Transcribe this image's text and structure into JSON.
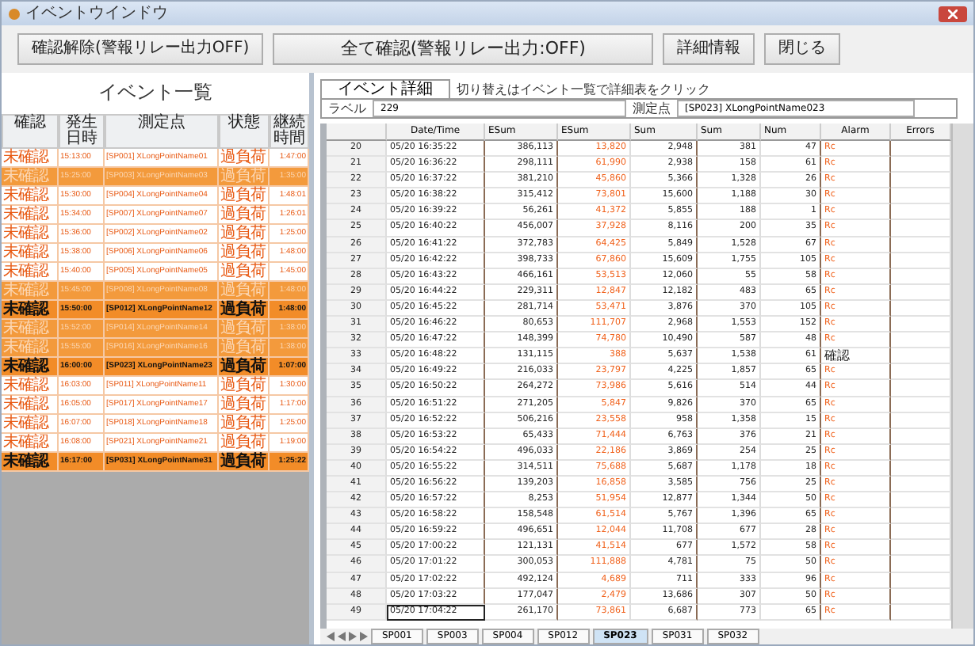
{
  "window": {
    "title": "イベントウインドウ"
  },
  "toolbar": {
    "buttons": [
      "確認解除(警報リレー出力OFF)",
      "全て確認(警報リレー出力:OFF)",
      "詳細情報",
      "閉じる"
    ]
  },
  "event_list": {
    "title": "イベント一覧",
    "columns": [
      "確認",
      "発生日時",
      "測定点",
      "状態",
      "継続時間"
    ],
    "rows": [
      {
        "kind": "plain",
        "ack": "未確認",
        "time": "15:13:00",
        "point": "[SP001] XLongPointName01",
        "status": "過負荷",
        "duration": "1:47:00"
      },
      {
        "kind": "alert",
        "ack": "未確認",
        "time": "15:25:00",
        "point": "[SP003] XLongPointName03",
        "status": "過負荷",
        "duration": "1:35:00"
      },
      {
        "kind": "plain",
        "ack": "未確認",
        "time": "15:30:00",
        "point": "[SP004] XLongPointName04",
        "status": "過負荷",
        "duration": "1:48:01"
      },
      {
        "kind": "plain",
        "ack": "未確認",
        "time": "15:34:00",
        "point": "[SP007] XLongPointName07",
        "status": "過負荷",
        "duration": "1:26:01"
      },
      {
        "kind": "plain",
        "ack": "未確認",
        "time": "15:36:00",
        "point": "[SP002] XLongPointName02",
        "status": "過負荷",
        "duration": "1:25:00"
      },
      {
        "kind": "plain",
        "ack": "未確認",
        "time": "15:38:00",
        "point": "[SP006] XLongPointName06",
        "status": "過負荷",
        "duration": "1:48:00"
      },
      {
        "kind": "plain",
        "ack": "未確認",
        "time": "15:40:00",
        "point": "[SP005] XLongPointName05",
        "status": "過負荷",
        "duration": "1:45:00"
      },
      {
        "kind": "alert",
        "ack": "未確認",
        "time": "15:45:00",
        "point": "[SP008] XLongPointName08",
        "status": "過負荷",
        "duration": "1:48:00"
      },
      {
        "kind": "active",
        "ack": "未確認",
        "time": "15:50:00",
        "point": "[SP012] XLongPointName12",
        "status": "過負荷",
        "duration": "1:48:00"
      },
      {
        "kind": "alert",
        "ack": "未確認",
        "time": "15:52:00",
        "point": "[SP014] XLongPointName14",
        "status": "過負荷",
        "duration": "1:38:00"
      },
      {
        "kind": "alert",
        "ack": "未確認",
        "time": "15:55:00",
        "point": "[SP016] XLongPointName16",
        "status": "過負荷",
        "duration": "1:38:00"
      },
      {
        "kind": "active",
        "ack": "未確認",
        "time": "16:00:00",
        "point": "[SP023] XLongPointName23",
        "status": "過負荷",
        "duration": "1:07:00"
      },
      {
        "kind": "plain",
        "ack": "未確認",
        "time": "16:03:00",
        "point": "[SP011] XLongPointName11",
        "status": "過負荷",
        "duration": "1:30:00"
      },
      {
        "kind": "plain",
        "ack": "未確認",
        "time": "16:05:00",
        "point": "[SP017] XLongPointName17",
        "status": "過負荷",
        "duration": "1:17:00"
      },
      {
        "kind": "plain",
        "ack": "未確認",
        "time": "16:07:00",
        "point": "[SP018] XLongPointName18",
        "status": "過負荷",
        "duration": "1:25:00"
      },
      {
        "kind": "plain",
        "ack": "未確認",
        "time": "16:08:00",
        "point": "[SP021] XLongPointName21",
        "status": "過負荷",
        "duration": "1:19:00"
      },
      {
        "kind": "active",
        "ack": "未確認",
        "time": "16:17:00",
        "point": "[SP031] XLongPointName31",
        "status": "過負荷",
        "duration": "1:25:22"
      }
    ]
  },
  "detail": {
    "tab": "イベント詳細",
    "note": "切り替えはイベント一覧で詳細表をクリック",
    "fields": [
      {
        "label": "ラベル",
        "value": "229"
      },
      {
        "label": "測定点",
        "value": "[SP023] XLongPointName023"
      }
    ],
    "columns": [
      "Date/Time",
      "ESum",
      "ESum",
      "Sum",
      "Sum",
      "Num",
      "Alarm",
      "Errors"
    ],
    "rows": [
      {
        "no": "20",
        "time": "05/20 16:35:22",
        "c1": "386,113",
        "c2": "13,820",
        "c3": "2,948",
        "c4": "381",
        "c5": "47",
        "alarm": "Rc"
      },
      {
        "no": "21",
        "time": "05/20 16:36:22",
        "c1": "298,111",
        "c2": "61,990",
        "c3": "2,938",
        "c4": "158",
        "c5": "61",
        "alarm": "Rc"
      },
      {
        "no": "22",
        "time": "05/20 16:37:22",
        "c1": "381,210",
        "c2": "45,860",
        "c3": "5,366",
        "c4": "1,328",
        "c5": "26",
        "alarm": "Rc"
      },
      {
        "no": "23",
        "time": "05/20 16:38:22",
        "c1": "315,412",
        "c2": "73,801",
        "c3": "15,600",
        "c4": "1,188",
        "c5": "30",
        "alarm": "Rc"
      },
      {
        "no": "24",
        "time": "05/20 16:39:22",
        "c1": "56,261",
        "c2": "41,372",
        "c3": "5,855",
        "c4": "188",
        "c5": "1",
        "alarm": "Rc"
      },
      {
        "no": "25",
        "time": "05/20 16:40:22",
        "c1": "456,007",
        "c2": "37,928",
        "c3": "8,116",
        "c4": "200",
        "c5": "35",
        "alarm": "Rc"
      },
      {
        "no": "26",
        "time": "05/20 16:41:22",
        "c1": "372,783",
        "c2": "64,425",
        "c3": "5,849",
        "c4": "1,528",
        "c5": "67",
        "alarm": "Rc"
      },
      {
        "no": "27",
        "time": "05/20 16:42:22",
        "c1": "398,733",
        "c2": "67,860",
        "c3": "15,609",
        "c4": "1,755",
        "c5": "105",
        "alarm": "Rc"
      },
      {
        "no": "28",
        "time": "05/20 16:43:22",
        "c1": "466,161",
        "c2": "53,513",
        "c3": "12,060",
        "c4": "55",
        "c5": "58",
        "alarm": "Rc"
      },
      {
        "no": "29",
        "time": "05/20 16:44:22",
        "c1": "229,311",
        "c2": "12,847",
        "c3": "12,182",
        "c4": "483",
        "c5": "65",
        "alarm": "Rc"
      },
      {
        "no": "30",
        "time": "05/20 16:45:22",
        "c1": "281,714",
        "c2": "53,471",
        "c3": "3,876",
        "c4": "370",
        "c5": "105",
        "alarm": "Rc"
      },
      {
        "no": "31",
        "time": "05/20 16:46:22",
        "c1": "80,653",
        "c2": "111,707",
        "c3": "2,968",
        "c4": "1,553",
        "c5": "152",
        "alarm": "Rc"
      },
      {
        "no": "32",
        "time": "05/20 16:47:22",
        "c1": "148,399",
        "c2": "74,780",
        "c3": "10,490",
        "c4": "587",
        "c5": "48",
        "alarm": "Rc"
      },
      {
        "no": "33",
        "time": "05/20 16:48:22",
        "c1": "131,115",
        "c2": "388",
        "c3": "5,637",
        "c4": "1,538",
        "c5": "61",
        "alarm": "確認"
      },
      {
        "no": "34",
        "time": "05/20 16:49:22",
        "c1": "216,033",
        "c2": "23,797",
        "c3": "4,225",
        "c4": "1,857",
        "c5": "65",
        "alarm": "Rc"
      },
      {
        "no": "35",
        "time": "05/20 16:50:22",
        "c1": "264,272",
        "c2": "73,986",
        "c3": "5,616",
        "c4": "514",
        "c5": "44",
        "alarm": "Rc"
      },
      {
        "no": "36",
        "time": "05/20 16:51:22",
        "c1": "271,205",
        "c2": "5,847",
        "c3": "9,826",
        "c4": "370",
        "c5": "65",
        "alarm": "Rc"
      },
      {
        "no": "37",
        "time": "05/20 16:52:22",
        "c1": "506,216",
        "c2": "23,558",
        "c3": "958",
        "c4": "1,358",
        "c5": "15",
        "alarm": "Rc"
      },
      {
        "no": "38",
        "time": "05/20 16:53:22",
        "c1": "65,433",
        "c2": "71,444",
        "c3": "6,763",
        "c4": "376",
        "c5": "21",
        "alarm": "Rc"
      },
      {
        "no": "39",
        "time": "05/20 16:54:22",
        "c1": "496,033",
        "c2": "22,186",
        "c3": "3,869",
        "c4": "254",
        "c5": "25",
        "alarm": "Rc"
      },
      {
        "no": "40",
        "time": "05/20 16:55:22",
        "c1": "314,511",
        "c2": "75,688",
        "c3": "5,687",
        "c4": "1,178",
        "c5": "18",
        "alarm": "Rc"
      },
      {
        "no": "41",
        "time": "05/20 16:56:22",
        "c1": "139,203",
        "c2": "16,858",
        "c3": "3,585",
        "c4": "756",
        "c5": "25",
        "alarm": "Rc"
      },
      {
        "no": "42",
        "time": "05/20 16:57:22",
        "c1": "8,253",
        "c2": "51,954",
        "c3": "12,877",
        "c4": "1,344",
        "c5": "50",
        "alarm": "Rc"
      },
      {
        "no": "43",
        "time": "05/20 16:58:22",
        "c1": "158,548",
        "c2": "61,514",
        "c3": "5,767",
        "c4": "1,396",
        "c5": "65",
        "alarm": "Rc"
      },
      {
        "no": "44",
        "time": "05/20 16:59:22",
        "c1": "496,651",
        "c2": "12,044",
        "c3": "11,708",
        "c4": "677",
        "c5": "28",
        "alarm": "Rc"
      },
      {
        "no": "45",
        "time": "05/20 17:00:22",
        "c1": "121,131",
        "c2": "41,514",
        "c3": "677",
        "c4": "1,572",
        "c5": "58",
        "alarm": "Rc"
      },
      {
        "no": "46",
        "time": "05/20 17:01:22",
        "c1": "300,053",
        "c2": "111,888",
        "c3": "4,781",
        "c4": "75",
        "c5": "50",
        "alarm": "Rc"
      },
      {
        "no": "47",
        "time": "05/20 17:02:22",
        "c1": "492,124",
        "c2": "4,689",
        "c3": "711",
        "c4": "333",
        "c5": "96",
        "alarm": "Rc"
      },
      {
        "no": "48",
        "time": "05/20 17:03:22",
        "c1": "177,047",
        "c2": "2,479",
        "c3": "13,686",
        "c4": "307",
        "c5": "50",
        "alarm": "Rc"
      },
      {
        "no": "49",
        "time": "05/20 17:04:22",
        "c1": "261,170",
        "c2": "73,861",
        "c3": "6,687",
        "c4": "773",
        "c5": "65",
        "alarm": "Rc"
      }
    ],
    "sheets": [
      {
        "label": "SP001",
        "selected": false
      },
      {
        "label": "SP003",
        "selected": false
      },
      {
        "label": "SP004",
        "selected": false
      },
      {
        "label": "SP012",
        "selected": false
      },
      {
        "label": "SP023",
        "selected": true
      },
      {
        "label": "SP031",
        "selected": false
      },
      {
        "label": "SP032",
        "selected": false
      }
    ]
  }
}
